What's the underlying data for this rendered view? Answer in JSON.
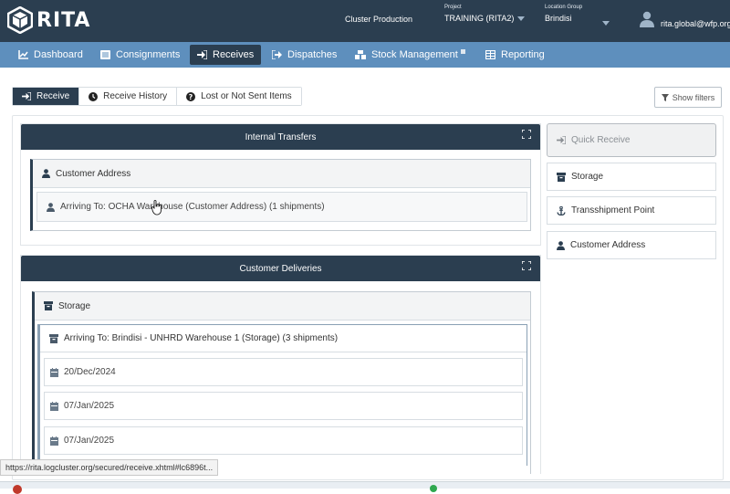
{
  "app": {
    "logo_text": "RITA"
  },
  "header": {
    "cluster": "Cluster Production",
    "project_caption": "Project",
    "project_value": "TRAINING (RITA2)",
    "location_caption": "Location Group",
    "location_value": "Brindisi",
    "user_email": "rita.global@wfp.org"
  },
  "nav": {
    "items": [
      {
        "label": "Dashboard",
        "icon": "chart-icon"
      },
      {
        "label": "Consignments",
        "icon": "list-icon"
      },
      {
        "label": "Receives",
        "icon": "sign-in-icon",
        "active": true
      },
      {
        "label": "Dispatches",
        "icon": "sign-out-icon"
      },
      {
        "label": "Stock Management",
        "icon": "cubes-icon"
      },
      {
        "label": "Reporting",
        "icon": "table-icon"
      }
    ]
  },
  "subtabs": {
    "items": [
      {
        "label": "Receive",
        "icon": "sign-in-icon",
        "active": true
      },
      {
        "label": "Receive History",
        "icon": "clock-icon"
      },
      {
        "label": "Lost or Not Sent Items",
        "icon": "question-icon"
      }
    ],
    "show_filters": "Show filters"
  },
  "internal_transfers": {
    "title": "Internal Transfers",
    "group_label": "Customer Address",
    "row_label": "Arriving To: OCHA Warehouse (Customer Address) (1 shipments)"
  },
  "customer_deliveries": {
    "title": "Customer Deliveries",
    "group_label": "Storage",
    "subgroup_label": "Arriving To: Brindisi - UNHRD Warehouse 1 (Storage) (3 shipments)",
    "dates": [
      "20/Dec/2024",
      "07/Jan/2025",
      "07/Jan/2025"
    ]
  },
  "side_menu": {
    "items": [
      {
        "label": "Quick Receive",
        "icon": "sign-in-icon"
      },
      {
        "label": "Storage",
        "icon": "archive-icon"
      },
      {
        "label": "Transshipment Point",
        "icon": "anchor-icon"
      },
      {
        "label": "Customer Address",
        "icon": "user-icon"
      }
    ]
  },
  "status_url": "https://rita.logcluster.org/secured/receive.xhtml#lc6896t...",
  "colors": {
    "header": "#2b3e50",
    "navbar": "#5e8fbd",
    "active": "#2b3e50"
  }
}
